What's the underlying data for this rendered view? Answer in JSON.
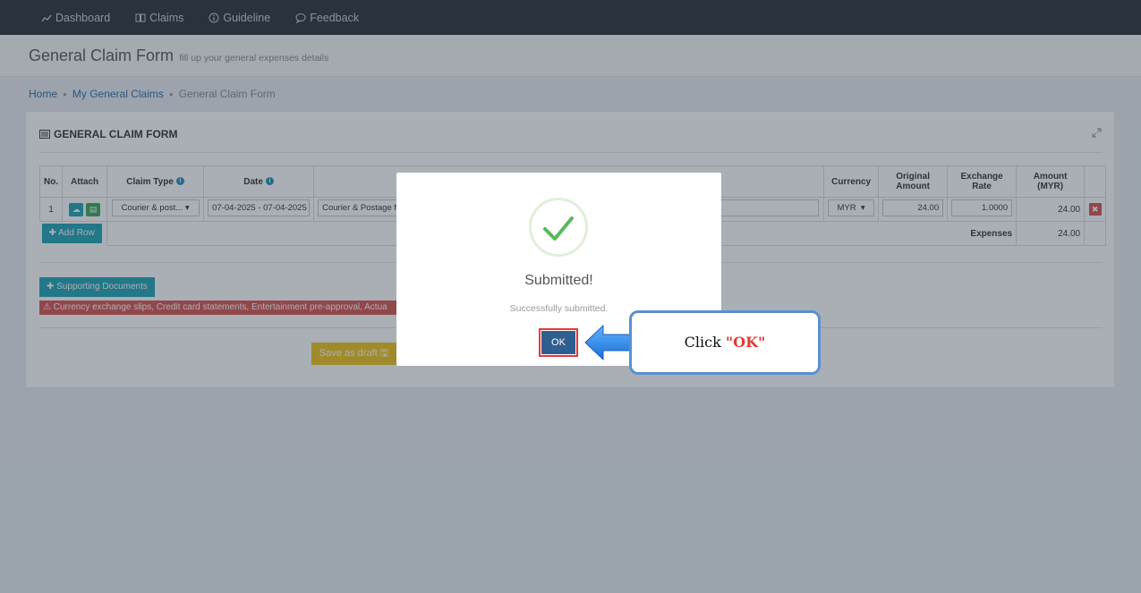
{
  "nav": {
    "items": [
      {
        "label": "Dashboard",
        "icon": "chart-line-icon"
      },
      {
        "label": "Claims",
        "icon": "book-icon"
      },
      {
        "label": "Guideline",
        "icon": "info-circle-icon"
      },
      {
        "label": "Feedback",
        "icon": "speech-bubble-icon"
      }
    ]
  },
  "header": {
    "title": "General Claim Form",
    "subtitle": "fill up your general expenses details"
  },
  "breadcrumb": {
    "home": "Home",
    "parent": "My General Claims",
    "current": "General Claim Form"
  },
  "panel": {
    "title": "GENERAL CLAIM FORM"
  },
  "table": {
    "headers": {
      "no": "No.",
      "attach": "Attach",
      "claim_type": "Claim Type",
      "date": "Date",
      "currency": "Currency",
      "original_amount": "Original Amount",
      "exchange_rate": "Exchange Rate",
      "amount_myr": "Amount (MYR)"
    },
    "rows": [
      {
        "no": "1",
        "claim_type": "Courier & post...",
        "date": "07-04-2025 - 07-04-2025",
        "description": "Courier & Postage fe",
        "currency": "MYR",
        "original_amount": "24.00",
        "exchange_rate": "1.0000",
        "amount": "24.00"
      }
    ],
    "add_row_label": "Add Row",
    "total_label": "Expenses",
    "total_value": "24.00"
  },
  "supporting_documents_label": "Supporting Documents",
  "warning_text": "Currency exchange slips, Credit card statements, Entertainment pre-approval, Actua",
  "save_draft_label": "Save as draft",
  "modal": {
    "title": "Submitted!",
    "text": "Successfully submitted.",
    "ok_label": "OK"
  },
  "callout": {
    "prefix": "Click ",
    "emphasis": "\"OK\""
  },
  "colors": {
    "nav_bg": "#2b3038",
    "accent_teal": "#1fa2b4",
    "danger": "#d9534f",
    "warning": "#f0c419",
    "ok_button": "#2f5f8e",
    "success_check": "#5cb85c",
    "callout_border": "#5b8fd1",
    "callout_arrow": "#2a8ef0"
  }
}
